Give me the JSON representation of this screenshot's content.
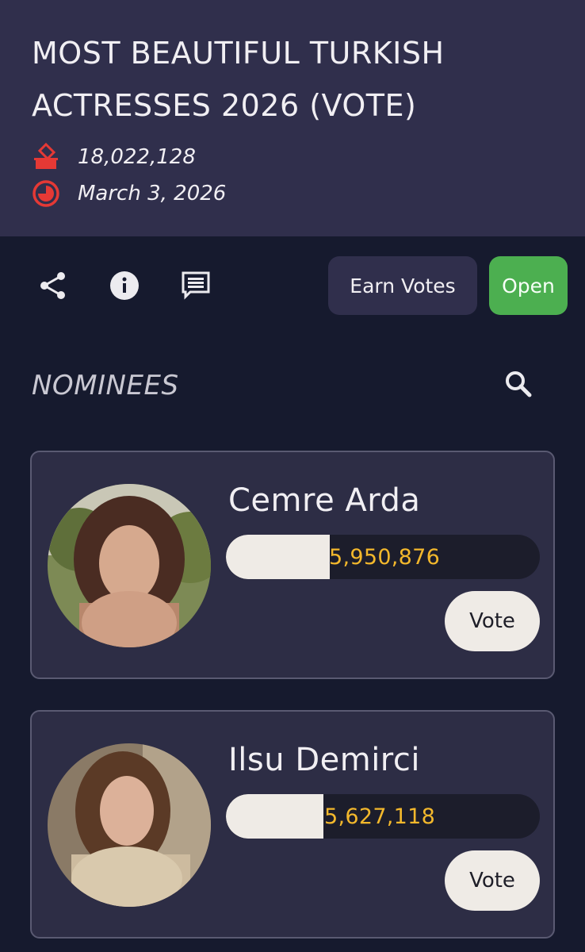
{
  "header": {
    "title": "MOST BEAUTIFUL TURKISH ACTRESSES 2026 (VOTE)",
    "total_votes": "18,022,128",
    "date": "March 3, 2026",
    "votes_icon": "ballot-box-icon",
    "date_icon": "clock-icon"
  },
  "toolbar": {
    "share_icon": "share-icon",
    "info_icon": "info-icon",
    "comments_icon": "comment-icon",
    "earn_votes_label": "Earn Votes",
    "open_label": "Open"
  },
  "nominees_section": {
    "title": "NOMINEES",
    "search_icon": "search-icon"
  },
  "nominees": [
    {
      "name": "Cemre Arda",
      "votes": "5,950,876",
      "progress_percent": 33,
      "vote_label": "Vote"
    },
    {
      "name": "Ilsu Demirci",
      "votes": "5,627,118",
      "progress_percent": 31,
      "vote_label": "Vote"
    }
  ],
  "colors": {
    "header_bg": "#302f4c",
    "page_bg": "#161a2e",
    "accent_red": "#e53935",
    "open_green": "#4caf50",
    "count_yellow": "#f3b82c"
  }
}
